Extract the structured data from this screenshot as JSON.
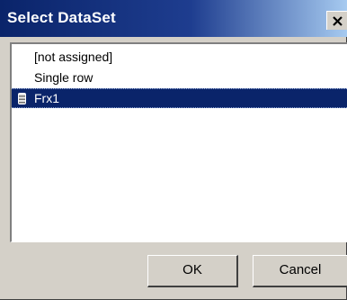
{
  "window": {
    "title": "Select DataSet",
    "close_icon": "close-icon"
  },
  "list": {
    "items": [
      {
        "label": "[not assigned]",
        "icon": null,
        "selected": false
      },
      {
        "label": "Single row",
        "icon": null,
        "selected": false
      },
      {
        "label": "Frx1",
        "icon": "database-icon",
        "selected": true
      }
    ]
  },
  "buttons": {
    "ok_label": "OK",
    "cancel_label": "Cancel"
  },
  "colors": {
    "title_bar": "#0a246a",
    "selection": "#0a246a",
    "face": "#d4d0c8"
  }
}
